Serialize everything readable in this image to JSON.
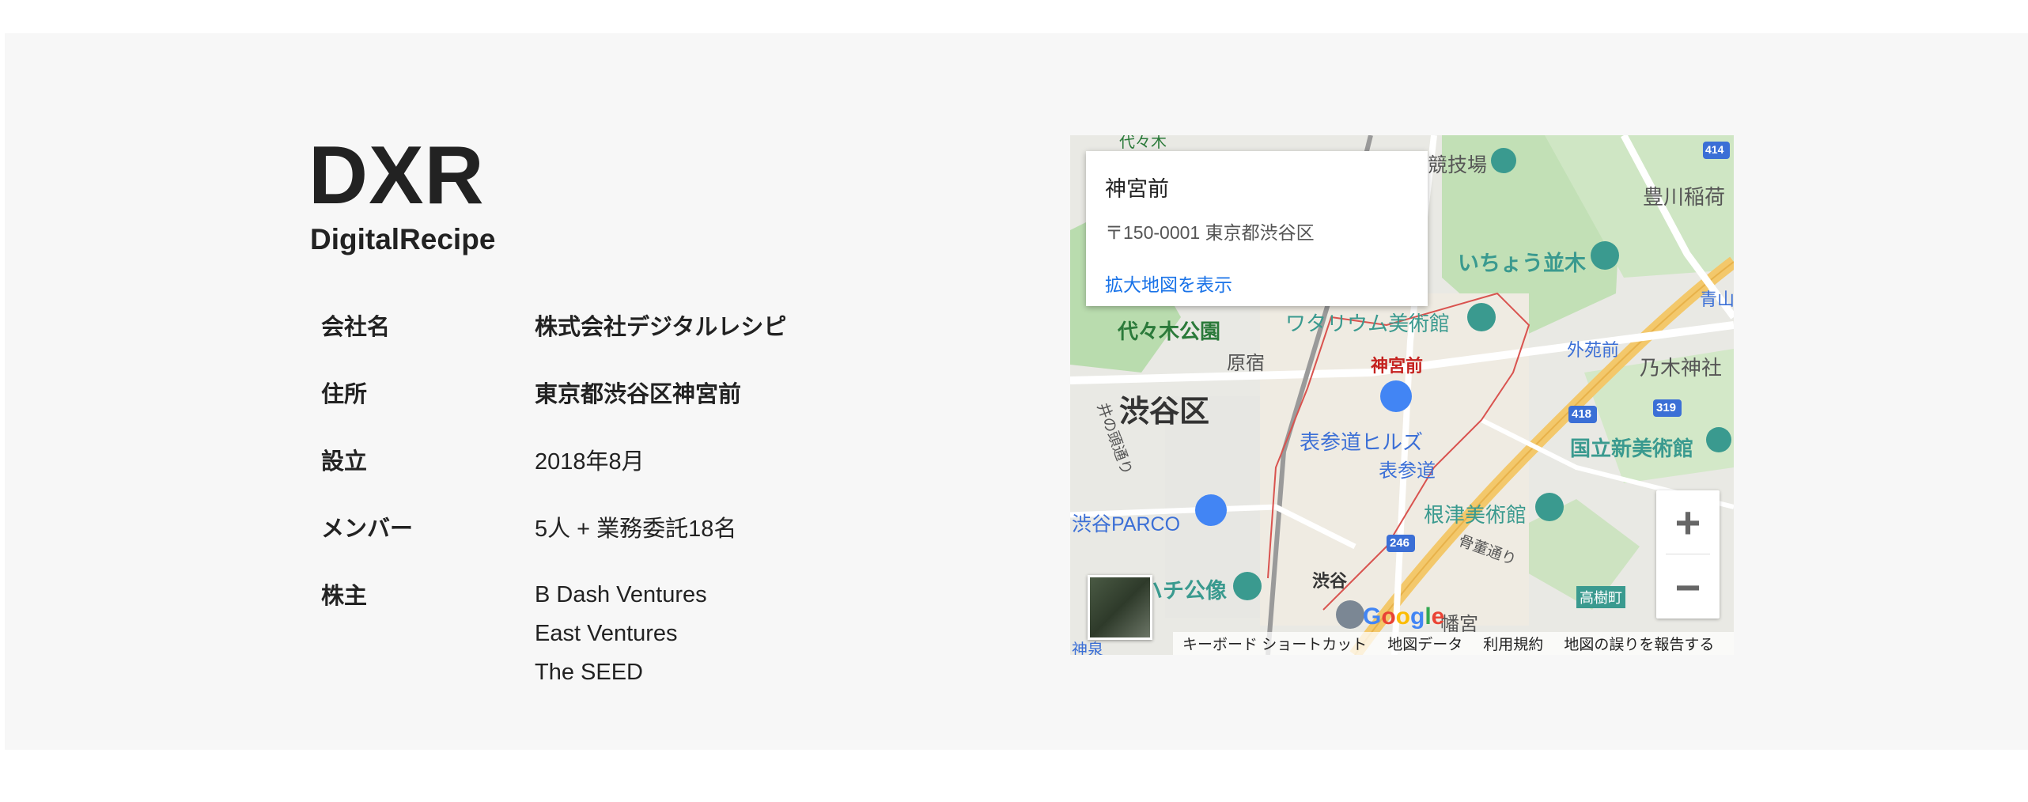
{
  "company": {
    "logo": "DXR",
    "name_en": "DigitalRecipe"
  },
  "info": [
    {
      "key": "会社名",
      "value": "株式会社デジタルレシピ"
    },
    {
      "key": "住所",
      "value": "東京都渋谷区神宮前"
    },
    {
      "key": "設立",
      "value": "2018年8月"
    },
    {
      "key": "メンバー",
      "value": "5人 + 業務委託18名"
    },
    {
      "key": "株主",
      "value": ""
    }
  ],
  "shareholders": [
    "B Dash Ventures",
    "East Ventures",
    "The SEED"
  ],
  "map": {
    "infowindow": {
      "title": "神宮前",
      "address": "〒150-0001 東京都渋谷区",
      "link": "拡大地図を表示"
    },
    "labels": {
      "yoyogi_park": "代々木公園",
      "shibuya_ku": "渋谷区",
      "jingumae": "神宮前",
      "harajuku": "原宿",
      "watarium": "ワタリウム美術館",
      "icho": "いちょう並木",
      "gaienmae": "外苑前",
      "nogi": "乃木神社",
      "omotesando_hills": "表参道ヒルズ",
      "omotesando": "表参道",
      "kokuritsu": "国立新美術館",
      "nezu": "根津美術館",
      "parco": "渋谷PARCO",
      "hachiko": "ハチ公像",
      "shibuya": "渋谷",
      "takagicho": "高樹町",
      "toyokawa": "豊川稲荷",
      "aoyama": "青山",
      "kotsu": "骨董通り",
      "inokashira": "井の頭通り",
      "hachimangu": "幡宮",
      "hanshin": "神泉",
      "kyogijo": "競技場",
      "yoyogi_top": "代々木",
      "route414": "414",
      "route418": "418",
      "route319": "319",
      "route246": "246"
    },
    "zoom_in": "+",
    "zoom_out": "−",
    "google": "Google",
    "footer": [
      "キーボード ショートカット",
      "地図データ",
      "利用規約",
      "地図の誤りを報告する"
    ]
  },
  "colors": {
    "panel_bg": "#f7f7f7",
    "text": "#222222",
    "link": "#1a73e8",
    "park": "#a8d5a2",
    "road_major": "#f3c86b",
    "district_border": "#d9534f",
    "poi_teal": "#3a9a8f"
  }
}
